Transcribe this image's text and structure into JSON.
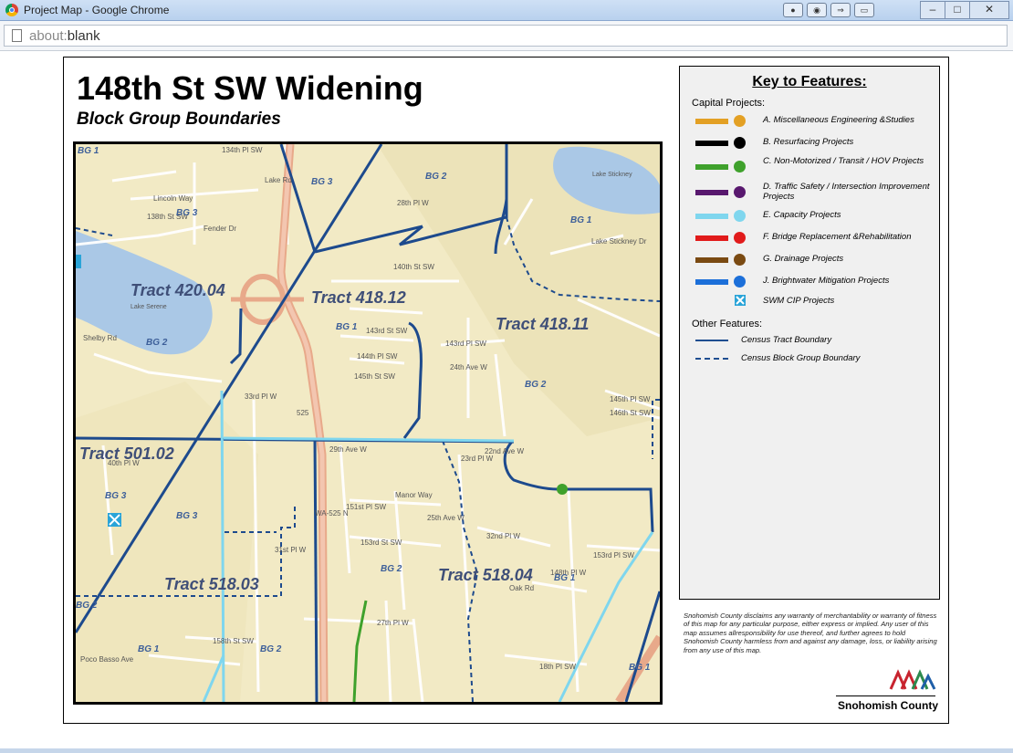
{
  "browser": {
    "window_title": "Project Map - Google Chrome",
    "url_scheme": "about:",
    "url_path": "blank",
    "window_controls": [
      "–",
      "□",
      "✕"
    ]
  },
  "map": {
    "title": "148th St SW Widening",
    "subtitle": "Block Group Boundaries",
    "tract_labels": [
      "Tract 420.04",
      "Tract 418.12",
      "Tract 418.11",
      "Tract 501.02",
      "Tract 518.03",
      "Tract 518.04"
    ],
    "block_group_labels": [
      "BG 1",
      "BG 2",
      "BG 3"
    ],
    "street_labels": [
      "134th Pl SW",
      "Lincoln Way",
      "138th St SW",
      "Fender Dr",
      "Lake Rd",
      "28th Pl W",
      "140th St SW",
      "143rd St SW",
      "144th Pl SW",
      "145th St SW",
      "143rd Pl SW",
      "24th Ave W",
      "Shelby Rd",
      "Lake Serene",
      "Lake Stickney",
      "Lake Stickney Dr",
      "33rd Pl W",
      "29th Ave W",
      "151st Pl SW",
      "153rd St SW",
      "Manor Way",
      "25th Ave W",
      "23rd Pl W",
      "22nd Ave W",
      "32nd Pl W",
      "Oak Rd",
      "18th Pl SW",
      "153rd Pl SW",
      "158th St SW",
      "27th Pl W",
      "31st Pl W",
      "145th Pl SW",
      "146th St SW",
      "148th Pl W",
      "40th Pl W",
      "Poco Basso Ave"
    ],
    "highway_labels": [
      "525",
      "WA-525 N"
    ]
  },
  "legend": {
    "title": "Key to Features:",
    "capital_heading": "Capital Projects:",
    "capital_items": [
      {
        "label": "A. Miscellaneous Engineering &Studies",
        "color": "#e3a024"
      },
      {
        "label": "B. Resurfacing Projects",
        "color": "#000000"
      },
      {
        "label": "C. Non-Motorized / Transit / HOV Projects",
        "color": "#3fa12c"
      },
      {
        "label": "D. Traffic Safety / Intersection Improvement Projects",
        "color": "#58186e"
      },
      {
        "label": "E. Capacity Projects",
        "color": "#7fd6ee"
      },
      {
        "label": "F. Bridge Replacement &Rehabilitation",
        "color": "#e11b1b"
      },
      {
        "label": "G. Drainage Projects",
        "color": "#7a4a12"
      },
      {
        "label": "J. Brightwater Mitigation Projects",
        "color": "#1c6fd9"
      },
      {
        "label": "SWM CIP Projects",
        "color": "#2aa4d8"
      }
    ],
    "other_heading": "Other Features:",
    "other_items": [
      {
        "label": "Census Tract Boundary",
        "style": "solid"
      },
      {
        "label": "Census Block Group Boundary",
        "style": "dashed"
      }
    ]
  },
  "disclaimer": "Snohomish County disclaims any warranty of merchantability or warranty of fitness of this map for any particular purpose, either express or implied. Any user of this map assumes allresponsibility for use thereof, and further agrees to hold Snohomish County harmless from and against any damage, loss, or liability arising from any use of this map.",
  "county": "Snohomish County"
}
